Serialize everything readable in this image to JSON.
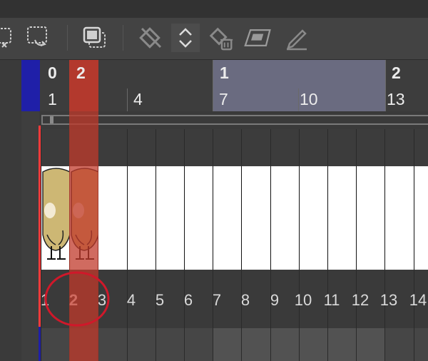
{
  "toolbar": {
    "buttons": [
      {
        "name": "paste-frames-button",
        "icon": "paste-frames-icon"
      },
      {
        "name": "copy-frames-button",
        "icon": "copy-frames-icon"
      },
      {
        "name": "frame-stack-button",
        "icon": "frame-stack-icon"
      },
      {
        "name": "rotate-disabled-button",
        "icon": "rotate-icon"
      },
      {
        "name": "expand-collapse-button",
        "icon": "up-down-chevron-icon"
      },
      {
        "name": "delete-cel-button",
        "icon": "trash-cel-icon"
      },
      {
        "name": "new-cel-button",
        "icon": "new-cel-icon"
      },
      {
        "name": "draw-cel-button",
        "icon": "pencil-icon"
      }
    ]
  },
  "header": {
    "second_labels": [
      "0",
      "2",
      "1",
      "2"
    ],
    "frame_labels": [
      "1",
      "4",
      "7",
      "10",
      "13"
    ],
    "current_second_label": "2"
  },
  "track": {
    "frame_numbers": [
      "1",
      "2",
      "3",
      "4",
      "5",
      "6",
      "7",
      "8",
      "9",
      "10",
      "11",
      "12",
      "13",
      "14"
    ],
    "current_frame": 2,
    "thumbnail_frames": [
      1,
      2
    ]
  },
  "colors": {
    "playhead": "#c0392b",
    "annotation_circle": "#d0182a",
    "range_highlight": "#6a6b80",
    "sidebar_blue": "#1f1fa8"
  }
}
